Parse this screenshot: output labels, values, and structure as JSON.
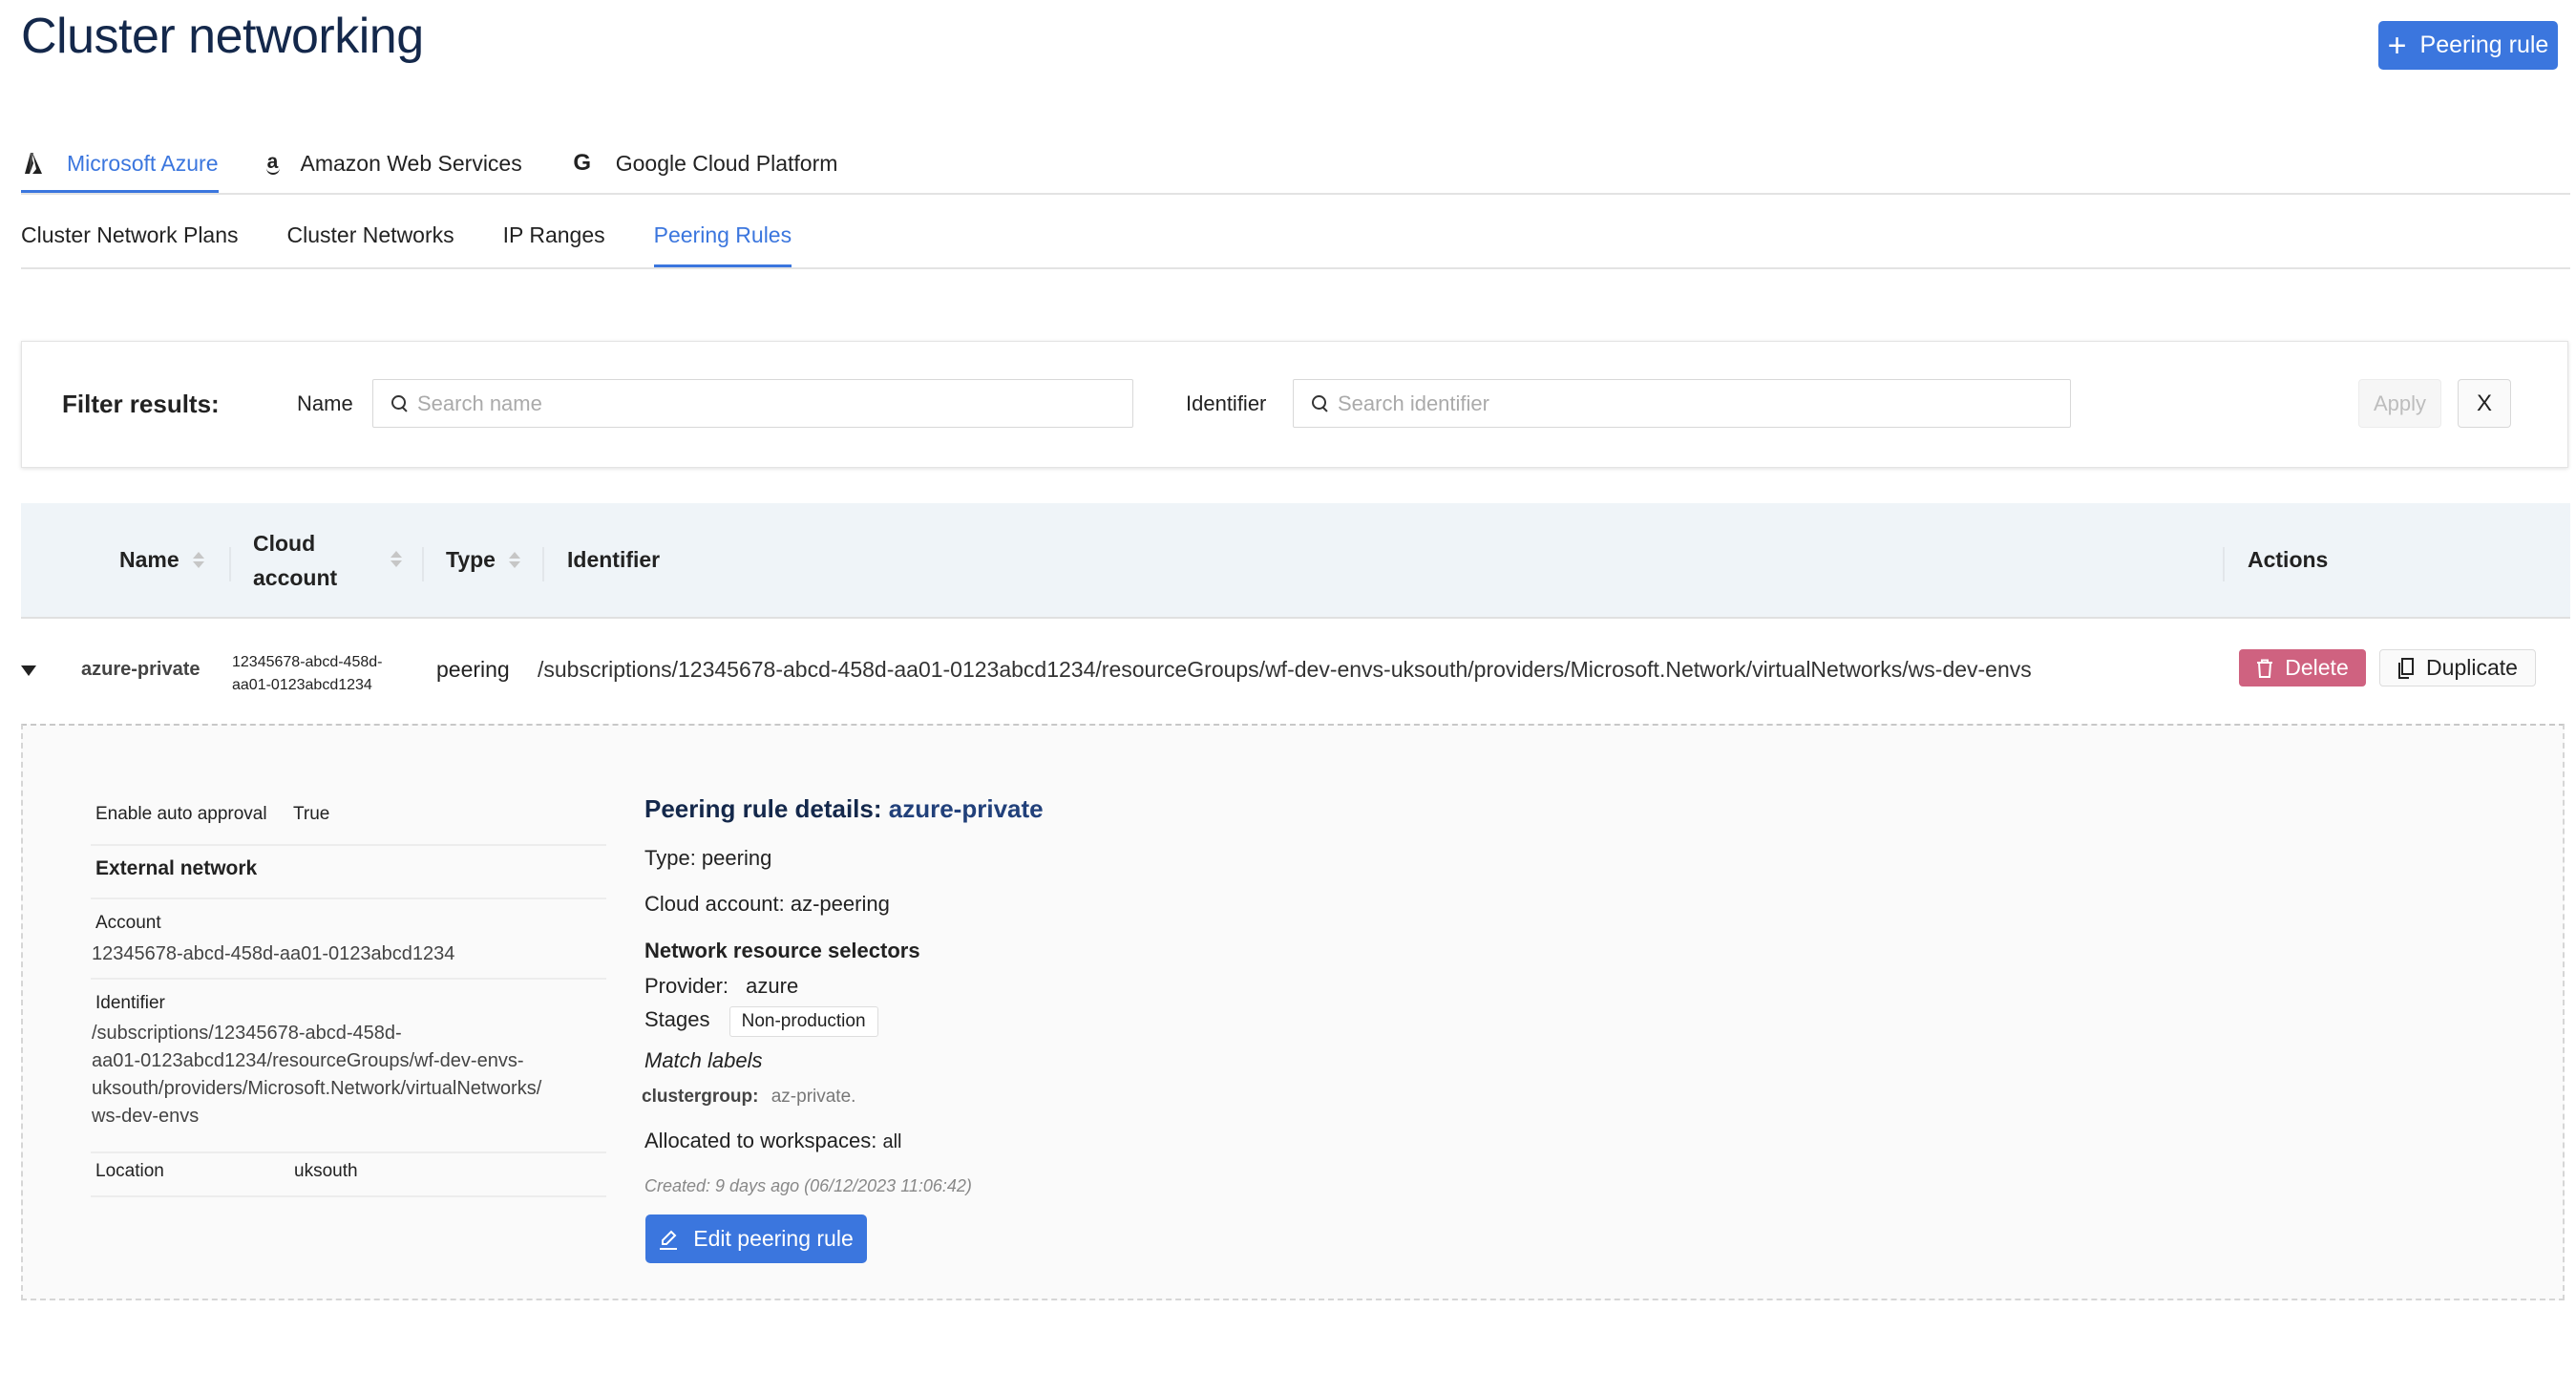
{
  "page": {
    "title": "Cluster networking",
    "add_button_label": "Peering rule"
  },
  "provider_tabs": [
    {
      "label": "Microsoft Azure",
      "icon": "azure-icon",
      "active": true
    },
    {
      "label": "Amazon Web Services",
      "icon": "amazon-icon",
      "active": false
    },
    {
      "label": "Google Cloud Platform",
      "icon": "google-icon",
      "active": false
    }
  ],
  "sub_tabs": [
    {
      "label": "Cluster Network Plans",
      "active": false
    },
    {
      "label": "Cluster Networks",
      "active": false
    },
    {
      "label": "IP Ranges",
      "active": false
    },
    {
      "label": "Peering Rules",
      "active": true
    }
  ],
  "filter": {
    "title": "Filter results:",
    "name_label": "Name",
    "name_placeholder": "Search name",
    "identifier_label": "Identifier",
    "identifier_placeholder": "Search identifier",
    "apply_label": "Apply",
    "clear_label": "X"
  },
  "table": {
    "columns": [
      "Name",
      "Cloud account",
      "Type",
      "Identifier",
      "Actions"
    ],
    "columns_wrapped": {
      "cloud_line1": "Cloud",
      "cloud_line2": "account"
    },
    "rows": [
      {
        "name": "azure-private",
        "cloud_account_line1": "12345678-abcd-458d-",
        "cloud_account_line2": "aa01-0123abcd1234",
        "type": "peering",
        "identifier": "/subscriptions/12345678-abcd-458d-aa01-0123abcd1234/resourceGroups/wf-dev-envs-uksouth/providers/Microsoft.Network/virtualNetworks/ws-dev-envs",
        "delete_label": "Delete",
        "duplicate_label": "Duplicate"
      }
    ]
  },
  "details": {
    "auto_approval_label": "Enable auto approval",
    "auto_approval_value": "True",
    "external_network_heading": "External network",
    "account_label": "Account",
    "account_value": "12345678-abcd-458d-aa01-0123abcd1234",
    "identifier_label": "Identifier",
    "identifier_lines": [
      "/subscriptions/12345678-abcd-458d-",
      "aa01-0123abcd1234/resourceGroups/wf-dev-envs-",
      "uksouth/providers/Microsoft.Network/virtualNetworks/",
      "ws-dev-envs"
    ],
    "location_label": "Location",
    "location_value": "uksouth",
    "heading_prefix": "Peering rule details:",
    "heading_name": "azure-private",
    "type_text": "Type: peering",
    "cloud_account_text": "Cloud account: az-peering",
    "selectors_heading": "Network resource selectors",
    "provider_label": "Provider:",
    "provider_value": "azure",
    "stages_label": "Stages",
    "stages_badge": "Non-production",
    "match_labels_heading": "Match labels",
    "label_key": "clustergroup:",
    "label_value": "az-private.",
    "allocated_label": "Allocated to workspaces:",
    "allocated_value": "all",
    "created_text": "Created: 9 days ago (06/12/2023 11:06:42)",
    "edit_button_label": "Edit peering rule"
  },
  "colors": {
    "accent": "#3b76de",
    "danger": "#cf6280",
    "title": "#14284b",
    "header_bg": "#eff4f8"
  }
}
